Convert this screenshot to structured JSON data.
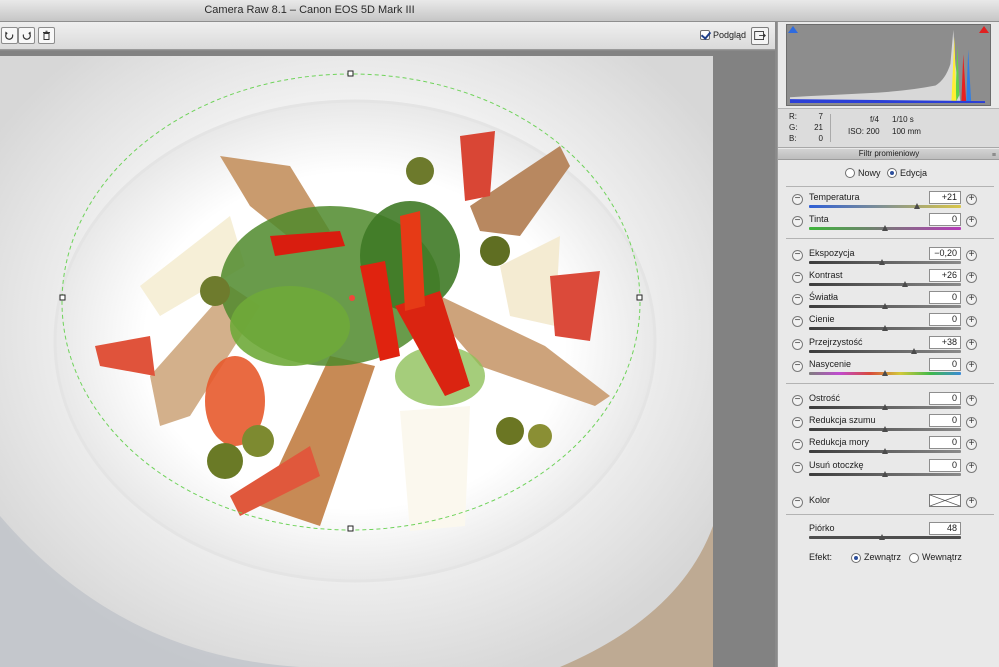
{
  "window": {
    "title": "Camera Raw 8.1  –  Canon EOS 5D Mark III"
  },
  "toolbar": {
    "buttons": [
      {
        "name": "rotate-left-button",
        "icon": "rotate-ccw-icon"
      },
      {
        "name": "rotate-right-button",
        "icon": "rotate-cw-icon"
      },
      {
        "name": "delete-button",
        "icon": "trash-icon"
      }
    ],
    "preview_label": "Podgląd",
    "preview_checked": true,
    "fullscreen_icon": "fullscreen-icon"
  },
  "histogram": {
    "readout": {
      "r_label": "R:",
      "r": "7",
      "g_label": "G:",
      "g": "21",
      "b_label": "B:",
      "b": "0"
    },
    "aperture": "f/4",
    "shutter": "1/10 s",
    "iso": "ISO: 200",
    "focal": "100 mm"
  },
  "panel": {
    "title": "Filtr promieniowy",
    "menu_icon": "panel-menu-icon",
    "mode": {
      "new_label": "Nowy",
      "edit_label": "Edycja",
      "selected": "edit"
    },
    "sliders": [
      {
        "label": "Temperatura",
        "value": "+21",
        "pos": 0.71,
        "track": "temperature"
      },
      {
        "label": "Tinta",
        "value": "0",
        "pos": 0.5,
        "track": "tint"
      },
      {
        "label": "Ekspozycja",
        "value": "−0,20",
        "pos": 0.48,
        "track": "gray"
      },
      {
        "label": "Kontrast",
        "value": "+26",
        "pos": 0.63,
        "track": "gray"
      },
      {
        "label": "Światła",
        "value": "0",
        "pos": 0.5,
        "track": "gray"
      },
      {
        "label": "Cienie",
        "value": "0",
        "pos": 0.5,
        "track": "gray"
      },
      {
        "label": "Przejrzystość",
        "value": "+38",
        "pos": 0.69,
        "track": "gray"
      },
      {
        "label": "Nasycenie",
        "value": "0",
        "pos": 0.5,
        "track": "saturation"
      },
      {
        "label": "Ostrość",
        "value": "0",
        "pos": 0.5,
        "track": "gray"
      },
      {
        "label": "Redukcja szumu",
        "value": "0",
        "pos": 0.5,
        "track": "gray"
      },
      {
        "label": "Redukcja mory",
        "value": "0",
        "pos": 0.5,
        "track": "gray"
      },
      {
        "label": "Usuń otoczkę",
        "value": "0",
        "pos": 0.5,
        "track": "gray"
      }
    ],
    "color": {
      "label": "Kolor"
    },
    "feather": {
      "label": "Piórko",
      "value": "48",
      "pos": 0.48
    },
    "effect": {
      "label": "Efekt:",
      "outside_label": "Zewnątrz",
      "inside_label": "Wewnątrz",
      "selected": "outside"
    }
  }
}
